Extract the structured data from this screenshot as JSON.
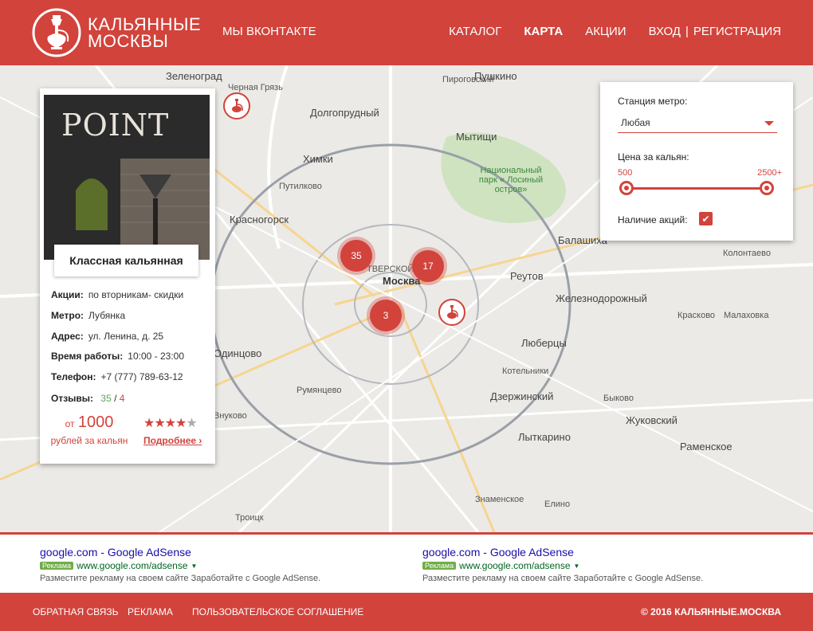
{
  "header": {
    "logo_line1": "КАЛЬЯННЫЕ",
    "logo_line2": "МОСКВЫ",
    "nav_left": "МЫ ВКОНТАКТЕ",
    "nav": {
      "catalog": "КАТАЛОГ",
      "map": "КАРТА",
      "promos": "АКЦИИ",
      "login": "ВХОД",
      "separator": "|",
      "register": "РЕГИСТРАЦИЯ"
    }
  },
  "map": {
    "labels": {
      "zelenograd": "Зеленоград",
      "dolgoprudny": "Долгопрудный",
      "pushkino": "Пушкино",
      "pirogovsky": "Пироговский",
      "mytishchi": "Мытищи",
      "khimki": "Химки",
      "national_park": "Национальный парк « Лосиный остров»",
      "krasnogorsk": "Красногорск",
      "putilkovo": "Путилково",
      "balashikha": "Балашиха",
      "reutov": "Реутов",
      "moskva": "Москва",
      "zheleznodorozhny": "Железнодорожный",
      "lyubertsy": "Люберцы",
      "odintsovo": "Одинцово",
      "dzerzhinsky": "Дзержинский",
      "zhukovsky": "Жуковский",
      "ramenskoye": "Раменское",
      "troitsk": "Троицк",
      "kotelniki": "Котельники",
      "lytkarino": "Лыткарино",
      "chernaya_gryaz": "Черная Грязь",
      "rumyantsevo": "Румянцево",
      "znamenskoye": "Знаменское",
      "elino": "Елино",
      "kolontaevo": "Колонтаево",
      "bykovo": "Быково",
      "kraskovo": "Красково",
      "malakhovka": "Малаховка",
      "vnukovo": "Внуково",
      "tverskoy": "ТВЕРСКОЙ"
    },
    "clusters": [
      "35",
      "17",
      "3"
    ]
  },
  "place_card": {
    "photo_text": "POINT",
    "title": "Классная кальянная",
    "promos_label": "Акции:",
    "promos_value": "по вторникам- скидки",
    "metro_label": "Метро:",
    "metro_value": "Лубянка",
    "address_label": "Адрес:",
    "address_value": "ул. Ленина, д. 25",
    "hours_label": "Время работы:",
    "hours_value": "10:00 - 23:00",
    "phone_label": "Телефон:",
    "phone_value": "+7 (777) 789-63-12",
    "reviews_label": "Отзывы:",
    "reviews_positive": "35",
    "reviews_sep": "/",
    "reviews_negative": "4",
    "price_from": "от",
    "price_value": "1000",
    "price_unit": "рублей за кальян",
    "rating": 4,
    "rating_max": 5,
    "more_link": "Подробнее ›"
  },
  "filter": {
    "metro_label": "Станция метро:",
    "metro_value": "Любая",
    "price_label": "Цена за кальян:",
    "price_min": "500",
    "price_max": "2500+",
    "promos_label": "Наличие акций:",
    "promos_checked": true
  },
  "ads": [
    {
      "title": "google.com - Google AdSense",
      "badge": "Реклама",
      "url": "www.google.com/adsense",
      "desc": "Разместите рекламу на своем сайте Заработайте с Google AdSense."
    },
    {
      "title": "google.com - Google AdSense",
      "badge": "Реклама",
      "url": "www.google.com/adsense",
      "desc": "Разместите рекламу на своем сайте Заработайте с Google AdSense."
    }
  ],
  "footer": {
    "feedback": "ОБРАТНАЯ СВЯЗЬ",
    "ads": "РЕКЛАМА",
    "agreement": "ПОЛЬЗОВАТЕЛЬСКОЕ СОГЛАШЕНИЕ",
    "copyright": "© 2016 КАЛЬЯННЫЕ.МОСКВА"
  },
  "colors": {
    "brand": "#d2433b",
    "map_bg": "#eceae6",
    "park": "#cfe3c1"
  }
}
